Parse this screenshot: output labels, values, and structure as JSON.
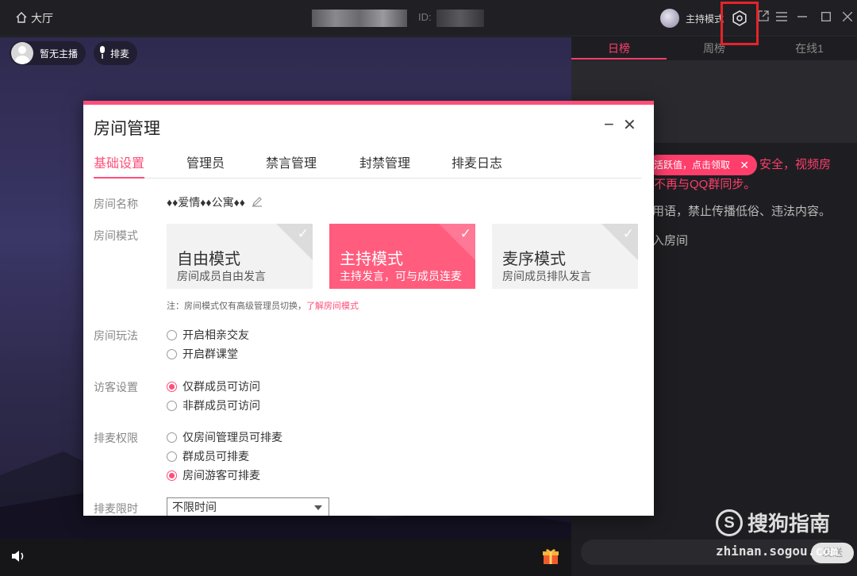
{
  "titlebar": {
    "hall_label": "大厅",
    "room_id_label": "ID:",
    "mode_label": "主持模式"
  },
  "stage": {
    "host_label": "暂无主播",
    "queue_label": "排麦"
  },
  "side": {
    "tabs": [
      "日榜",
      "周榜",
      "在线1"
    ],
    "toast": "活跃值，点击领取",
    "notice_lines": [
      "安全，视频房",
      "不再与QQ群同步。"
    ],
    "notice2": "用语，禁止传播低俗、违法内容。",
    "notice3": "入房间",
    "send_label": "发送"
  },
  "watermark": {
    "brand": "搜狗指南",
    "url": "zhinan.sogou.com"
  },
  "dialog": {
    "title": "房间管理",
    "tabs": [
      "基础设置",
      "管理员",
      "禁言管理",
      "封禁管理",
      "排麦日志"
    ],
    "labels": {
      "room_name": "房间名称",
      "room_mode": "房间模式",
      "room_play": "房间玩法",
      "visitor": "访客设置",
      "queue_perm": "排麦权限",
      "queue_time": "排麦限时"
    },
    "room_name": "♦♦爱情♦♦公寓♦♦",
    "modes": [
      {
        "title": "自由模式",
        "desc": "房间成员自由发言"
      },
      {
        "title": "主持模式",
        "desc": "主持发言，可与成员连麦"
      },
      {
        "title": "麦序模式",
        "desc": "房间成员排队发言"
      }
    ],
    "mode_note": "注：房间模式仅有高级管理员切换，",
    "mode_note_link": "了解房间模式",
    "play_options": [
      "开启相亲交友",
      "开启群课堂"
    ],
    "visitor_options": [
      "仅群成员可访问",
      "非群成员可访问"
    ],
    "queue_options": [
      "仅房间管理员可排麦",
      "群成员可排麦",
      "房间游客可排麦"
    ],
    "queue_time_value": "不限时间"
  },
  "colors": {
    "accent": "#ff4e79",
    "highlight_box": "#e6232a"
  }
}
